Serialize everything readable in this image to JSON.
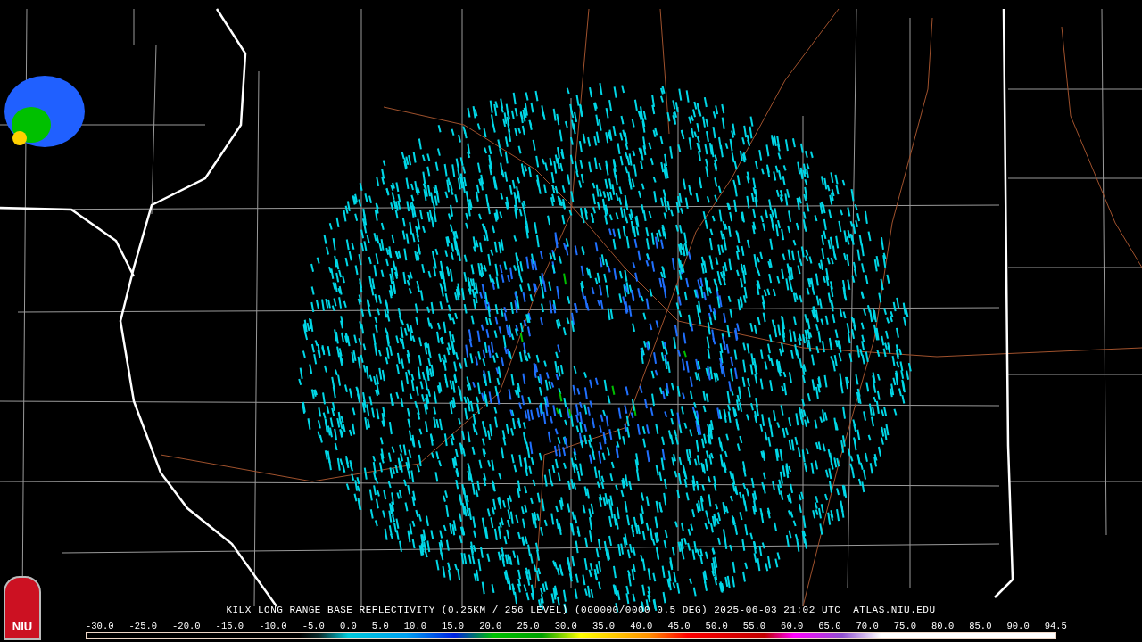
{
  "logo": {
    "text": "NIU"
  },
  "caption": {
    "title": "KILX LONG RANGE BASE REFLECTIVITY (0.25KM / 256 LEVEL) (000000/0000 0.5 DEG) 2025-06-03 21:02 UTC",
    "credit": "ATLAS.NIU.EDU"
  },
  "legend": {
    "labels": [
      "-30.0",
      "-25.0",
      "-20.0",
      "-15.0",
      "-10.0",
      "-5.0",
      "0.0",
      "5.0",
      "10.0",
      "15.0",
      "20.0",
      "25.0",
      "30.0",
      "35.0",
      "40.0",
      "45.0",
      "50.0",
      "55.0",
      "60.0",
      "65.0",
      "70.0",
      "75.0",
      "80.0",
      "85.0",
      "90.0",
      "94.5"
    ]
  }
}
